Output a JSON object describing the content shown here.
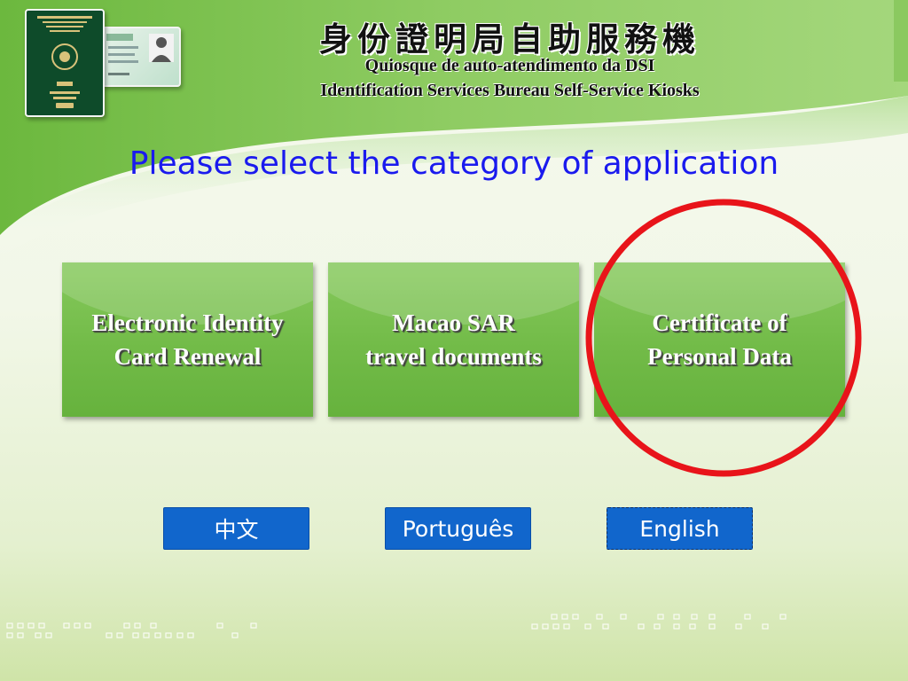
{
  "header": {
    "title_zh": "身份證明局自助服務機",
    "title_pt": "Quiosque de auto-atendimento da DSI",
    "title_en": "Identification Services Bureau Self-Service Kiosks"
  },
  "prompt": "Please select the category of application",
  "categories": [
    {
      "line1": "Electronic Identity",
      "line2": "Card Renewal"
    },
    {
      "line1": "Macao SAR",
      "line2": "travel documents"
    },
    {
      "line1": "Certificate of",
      "line2": "Personal Data"
    }
  ],
  "languages": [
    "中文",
    "Português",
    "English"
  ],
  "highlight": {
    "target": "Certificate of Personal Data",
    "color": "#e8141a"
  },
  "colors": {
    "accent_blue": "#1166cc",
    "prompt_blue": "#1a1aee",
    "tile_green": "#72bb48"
  }
}
